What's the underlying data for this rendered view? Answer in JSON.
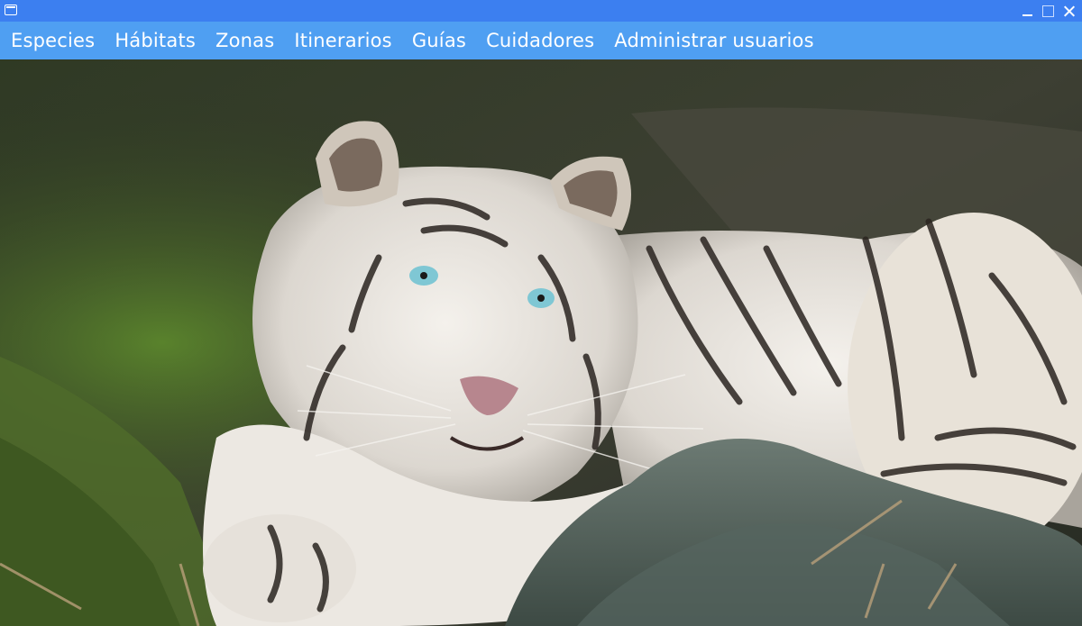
{
  "window": {
    "icon": "app-window-icon",
    "controls": [
      "minimize-icon",
      "maximize-icon",
      "close-icon"
    ]
  },
  "menu": {
    "items": [
      {
        "label": "Especies"
      },
      {
        "label": "Hábitats"
      },
      {
        "label": "Zonas"
      },
      {
        "label": "Itinerarios"
      },
      {
        "label": "Guías"
      },
      {
        "label": "Cuidadores"
      },
      {
        "label": "Administrar usuarios"
      }
    ]
  },
  "colors": {
    "titlebar": "#3c7ff0",
    "menubar": "#4f9ff2",
    "menu_text": "#ffffff"
  },
  "background_image": {
    "subject": "white tiger resting on a rock"
  }
}
